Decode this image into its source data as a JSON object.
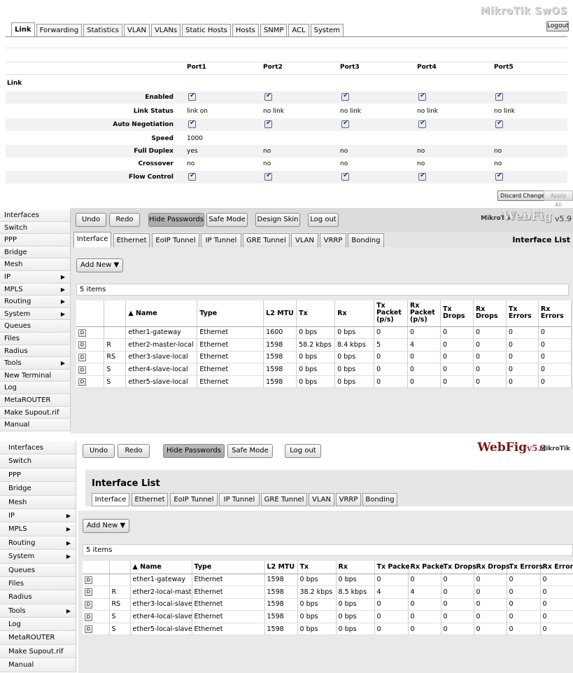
{
  "swos": {
    "brand": "MikroTik SwOS",
    "logout": "Logout",
    "tabs": [
      "Link",
      "Forwarding",
      "Statistics",
      "VLAN",
      "VLANs",
      "Static Hosts",
      "Hosts",
      "SNMP",
      "ACL",
      "System"
    ],
    "ports": [
      "Port1",
      "Port2",
      "Port3",
      "Port4",
      "Port5"
    ],
    "section": "Link",
    "rows": {
      "enabled": {
        "label": "Enabled",
        "values": [
          true,
          true,
          true,
          true,
          true
        ]
      },
      "link_status": {
        "label": "Link Status",
        "values": [
          "link on",
          "no link",
          "no link",
          "no link",
          "no link"
        ]
      },
      "auto_negotiation": {
        "label": "Auto Negotiation",
        "values": [
          true,
          true,
          true,
          true,
          true
        ]
      },
      "speed": {
        "label": "Speed",
        "values": [
          "1000",
          "",
          "",
          "",
          ""
        ]
      },
      "full_duplex": {
        "label": "Full Duplex",
        "values": [
          "yes",
          "no",
          "no",
          "no",
          "no"
        ]
      },
      "crossover": {
        "label": "Crossover",
        "values": [
          "no",
          "no",
          "no",
          "no",
          "no"
        ]
      },
      "flow_control": {
        "label": "Flow Control",
        "values": [
          true,
          true,
          true,
          true,
          true
        ]
      }
    },
    "discard": "Discard Changes",
    "apply": "Apply All"
  },
  "wf59": {
    "sidebar": [
      "Interfaces",
      "Switch",
      "PPP",
      "Bridge",
      "Mesh",
      "IP",
      "MPLS",
      "Routing",
      "System",
      "Queues",
      "Files",
      "Radius",
      "Tools",
      "New Terminal",
      "Log",
      "MetaROUTER",
      "Make Supout.rif",
      "Manual"
    ],
    "buttons": {
      "undo": "Undo",
      "redo": "Redo",
      "hide_passwords": "Hide Passwords",
      "safe_mode": "Safe Mode",
      "design_skin": "Design Skin",
      "log_out": "Log out"
    },
    "logo_mikrotik": "MikroTik",
    "logo_webfig": "WebFig",
    "logo_version": "v5.9",
    "tabs": [
      "Interface",
      "Ethernet",
      "EoIP Tunnel",
      "IP Tunnel",
      "GRE Tunnel",
      "VLAN",
      "VRRP",
      "Bonding"
    ],
    "page_title": "Interface List",
    "add_new": "Add New ▼",
    "items_count": "5 items",
    "columns": {
      "name": "▲ Name",
      "type": "Type",
      "l2mtu": "L2 MTU",
      "tx": "Tx",
      "rx": "Rx",
      "txpkt": "Tx Packet (p/s)",
      "rxpkt": "Rx Packet (p/s)",
      "txdrops": "Tx Drops",
      "rxdrops": "Rx Drops",
      "txerrors": "Tx Errors",
      "rxerrors": "Rx Errors"
    },
    "disable_label": "D",
    "rows": [
      {
        "flag": "",
        "name": "ether1-gateway",
        "type": "Ethernet",
        "l2mtu": "1600",
        "tx": "0 bps",
        "rx": "0 bps",
        "txpkt": "0",
        "rxpkt": "0",
        "txdrops": "0",
        "rxdrops": "0",
        "txerrors": "0",
        "rxerrors": "0"
      },
      {
        "flag": "R",
        "name": "ether2-master-local",
        "type": "Ethernet",
        "l2mtu": "1598",
        "tx": "58.2 kbps",
        "rx": "8.4 kbps",
        "txpkt": "5",
        "rxpkt": "4",
        "txdrops": "0",
        "rxdrops": "0",
        "txerrors": "0",
        "rxerrors": "0"
      },
      {
        "flag": "RS",
        "name": "ether3-slave-local",
        "type": "Ethernet",
        "l2mtu": "1598",
        "tx": "0 bps",
        "rx": "0 bps",
        "txpkt": "0",
        "rxpkt": "0",
        "txdrops": "0",
        "rxdrops": "0",
        "txerrors": "0",
        "rxerrors": "0"
      },
      {
        "flag": "S",
        "name": "ether4-slave-local",
        "type": "Ethernet",
        "l2mtu": "1598",
        "tx": "0 bps",
        "rx": "0 bps",
        "txpkt": "0",
        "rxpkt": "0",
        "txdrops": "0",
        "rxdrops": "0",
        "txerrors": "0",
        "rxerrors": "0"
      },
      {
        "flag": "S",
        "name": "ether5-slave-local",
        "type": "Ethernet",
        "l2mtu": "1598",
        "tx": "0 bps",
        "rx": "0 bps",
        "txpkt": "0",
        "rxpkt": "0",
        "txdrops": "0",
        "rxdrops": "0",
        "txerrors": "0",
        "rxerrors": "0"
      }
    ]
  },
  "wf52": {
    "sidebar": [
      "Interfaces",
      "Switch",
      "PPP",
      "Bridge",
      "Mesh",
      "IP",
      "MPLS",
      "Routing",
      "System",
      "Queues",
      "Files",
      "Radius",
      "Tools",
      "Log",
      "MetaROUTER",
      "Make Supout.rif",
      "Manual"
    ],
    "buttons": {
      "undo": "Undo",
      "redo": "Redo",
      "hide_passwords": "Hide Passwords",
      "safe_mode": "Safe Mode",
      "log_out": "Log out"
    },
    "logo_webfig": "WebFig",
    "logo_version": "v5.2",
    "logo_mikrotik": "MikroTik",
    "page_title": "Interface List",
    "tabs": [
      "Interface",
      "Ethernet",
      "EoIP Tunnel",
      "IP Tunnel",
      "GRE Tunnel",
      "VLAN",
      "VRRP",
      "Bonding"
    ],
    "add_new": "Add New ▼",
    "items_count": "5 items",
    "columns": {
      "name": "▲ Name",
      "type": "Type",
      "l2mtu": "L2 MTU",
      "tx": "Tx",
      "rx": "Rx",
      "txpkt": "Tx Packe",
      "rxpkt": "Rx Packe",
      "txdrops": "Tx Drops",
      "rxdrops": "Rx Drops",
      "txerrors": "Tx Errors",
      "rxerrors": "Rx Error"
    },
    "disable_label": "D",
    "rows": [
      {
        "flag": "",
        "name": "ether1-gateway",
        "type": "Ethernet",
        "l2mtu": "1598",
        "tx": "0 bps",
        "rx": "0 bps",
        "txpkt": "0",
        "rxpkt": "0",
        "txdrops": "0",
        "rxdrops": "0",
        "txerrors": "0",
        "rxerrors": "0"
      },
      {
        "flag": "R",
        "name": "ether2-local-maste",
        "type": "Ethernet",
        "l2mtu": "1598",
        "tx": "38.2 kbps",
        "rx": "8.5 kbps",
        "txpkt": "4",
        "rxpkt": "4",
        "txdrops": "0",
        "rxdrops": "0",
        "txerrors": "0",
        "rxerrors": "0"
      },
      {
        "flag": "RS",
        "name": "ether3-local-slave",
        "type": "Ethernet",
        "l2mtu": "1598",
        "tx": "0 bps",
        "rx": "0 bps",
        "txpkt": "0",
        "rxpkt": "0",
        "txdrops": "0",
        "rxdrops": "0",
        "txerrors": "0",
        "rxerrors": "0"
      },
      {
        "flag": "S",
        "name": "ether4-local-slave",
        "type": "Ethernet",
        "l2mtu": "1598",
        "tx": "0 bps",
        "rx": "0 bps",
        "txpkt": "0",
        "rxpkt": "0",
        "txdrops": "0",
        "rxdrops": "0",
        "txerrors": "0",
        "rxerrors": "0"
      },
      {
        "flag": "S",
        "name": "ether5-local-slave",
        "type": "Ethernet",
        "l2mtu": "1598",
        "tx": "0 bps",
        "rx": "0 bps",
        "txpkt": "0",
        "rxpkt": "0",
        "txdrops": "0",
        "rxdrops": "0",
        "txerrors": "0",
        "rxerrors": "0"
      }
    ]
  }
}
